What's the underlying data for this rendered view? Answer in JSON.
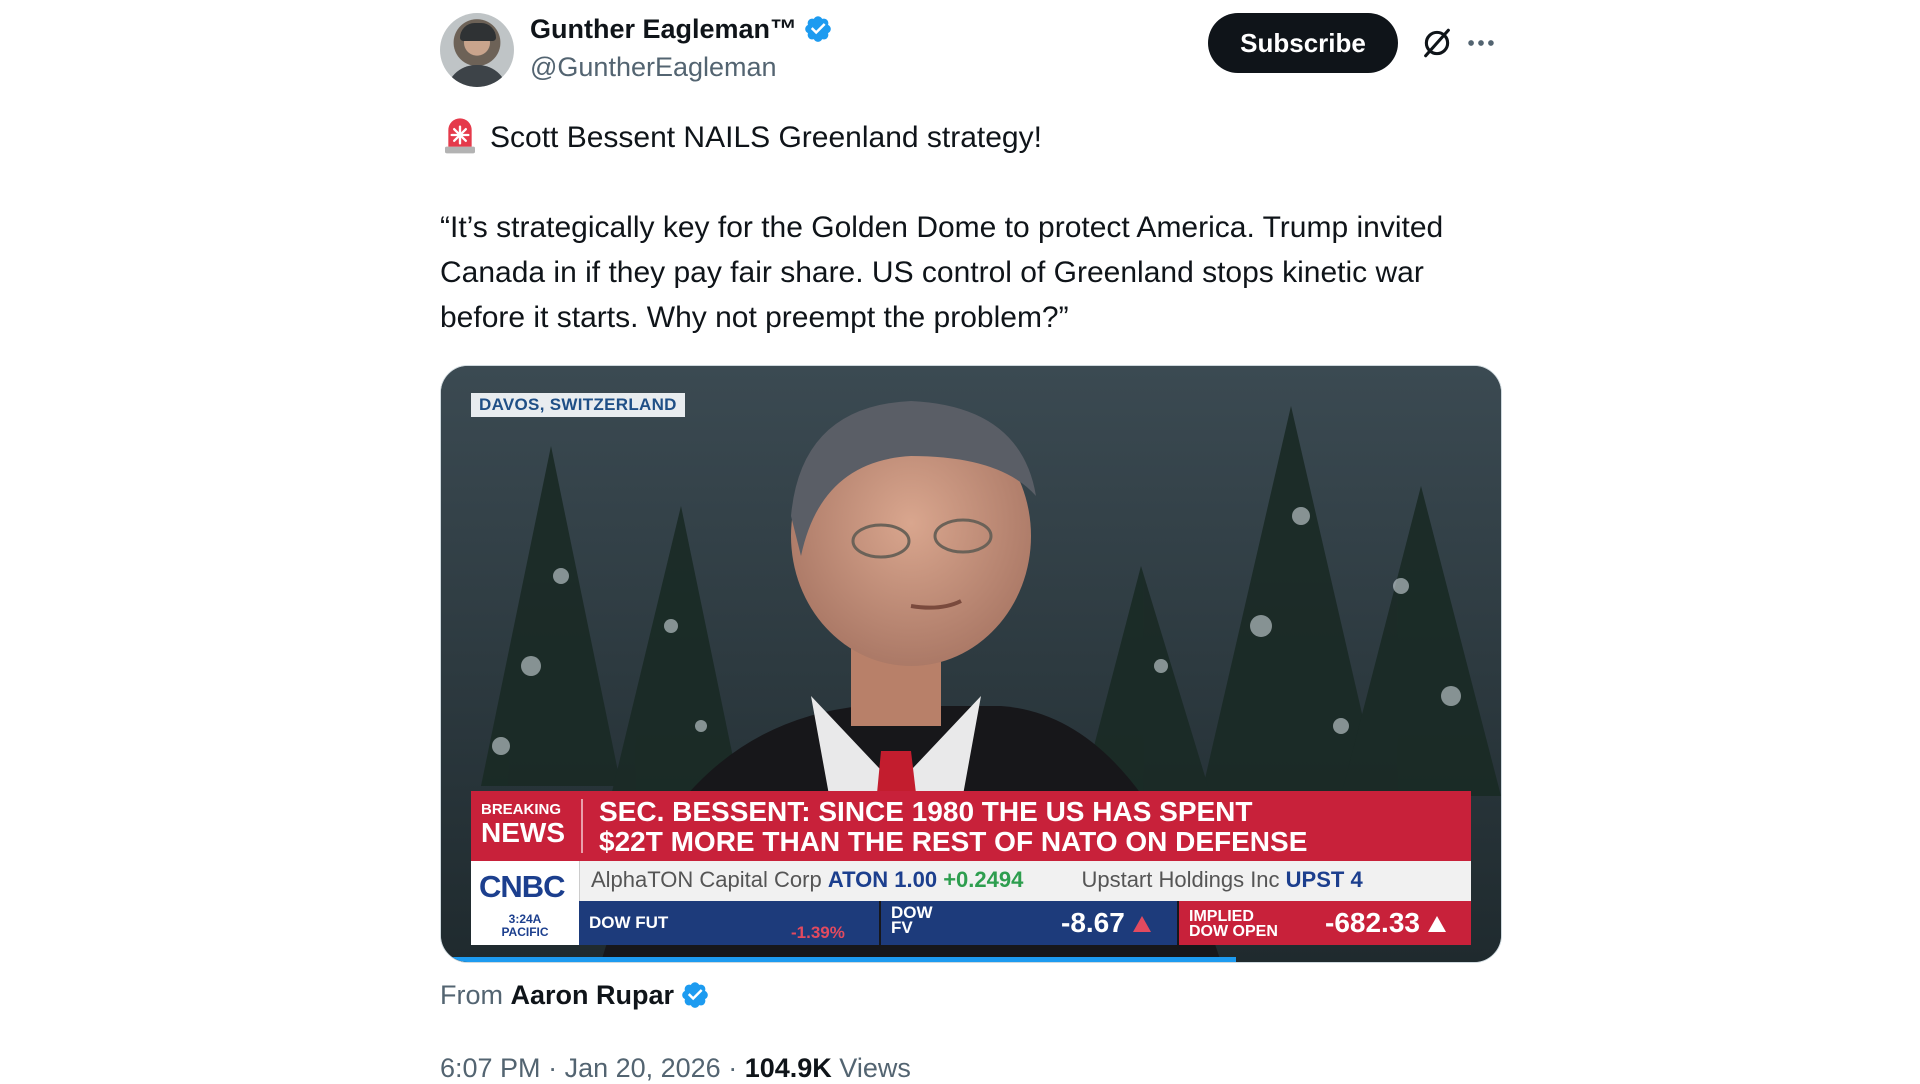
{
  "author": {
    "name": "Gunther Eagleman™",
    "handle": "@GuntherEagleman",
    "verified": true
  },
  "actions": {
    "subscribe_label": "Subscribe",
    "grok_icon": "grok-icon",
    "more_icon": "more-icon"
  },
  "tweet": {
    "emoji": "siren-icon",
    "line1": "Scott Bessent NAILS Greenland strategy!",
    "quote": "“It’s strategically key for the Golden Dome to protect America. Trump invited Canada in if they pay fair share. US control of Greenland stops kinetic war before it starts. Why not preempt the problem?”"
  },
  "video": {
    "location_tag": "DAVOS, SWITZERLAND",
    "breaking_label_top": "BREAKING",
    "breaking_label_bottom": "NEWS",
    "headline_line1": "SEC. BESSENT: SINCE 1980 THE US HAS SPENT",
    "headline_line2": "$22T MORE THAN THE REST OF NATO ON DEFENSE",
    "network": "CNBC",
    "time": "3:24A",
    "timezone": "PACIFIC",
    "ticker": {
      "company1": "AlphaTON Capital Corp",
      "symbol1": "ATON 1.00",
      "change1": "+0.2494",
      "company2": "Upstart Holdings Inc",
      "symbol2": "UPST 4"
    },
    "dow_fut_label": "DOW FUT",
    "dow_fut_pct": "-1.39%",
    "dow_fv_label_1": "DOW",
    "dow_fv_label_2": "FV",
    "dow_fv_value": "-8.67",
    "implied_label_1": "IMPLIED",
    "implied_label_2": "DOW OPEN",
    "implied_value": "-682.33",
    "playback_progress": 0.75
  },
  "source": {
    "prefix": "From",
    "name": "Aaron Rupar",
    "verified": true
  },
  "meta": {
    "time": "6:07 PM",
    "date": "Jan 20, 2026",
    "views_count": "104.9K",
    "views_label": "Views"
  },
  "colors": {
    "verified_blue": "#1d9bf0",
    "cnbc_blue": "#1c3f8e",
    "breaking_red": "#c8213a"
  }
}
